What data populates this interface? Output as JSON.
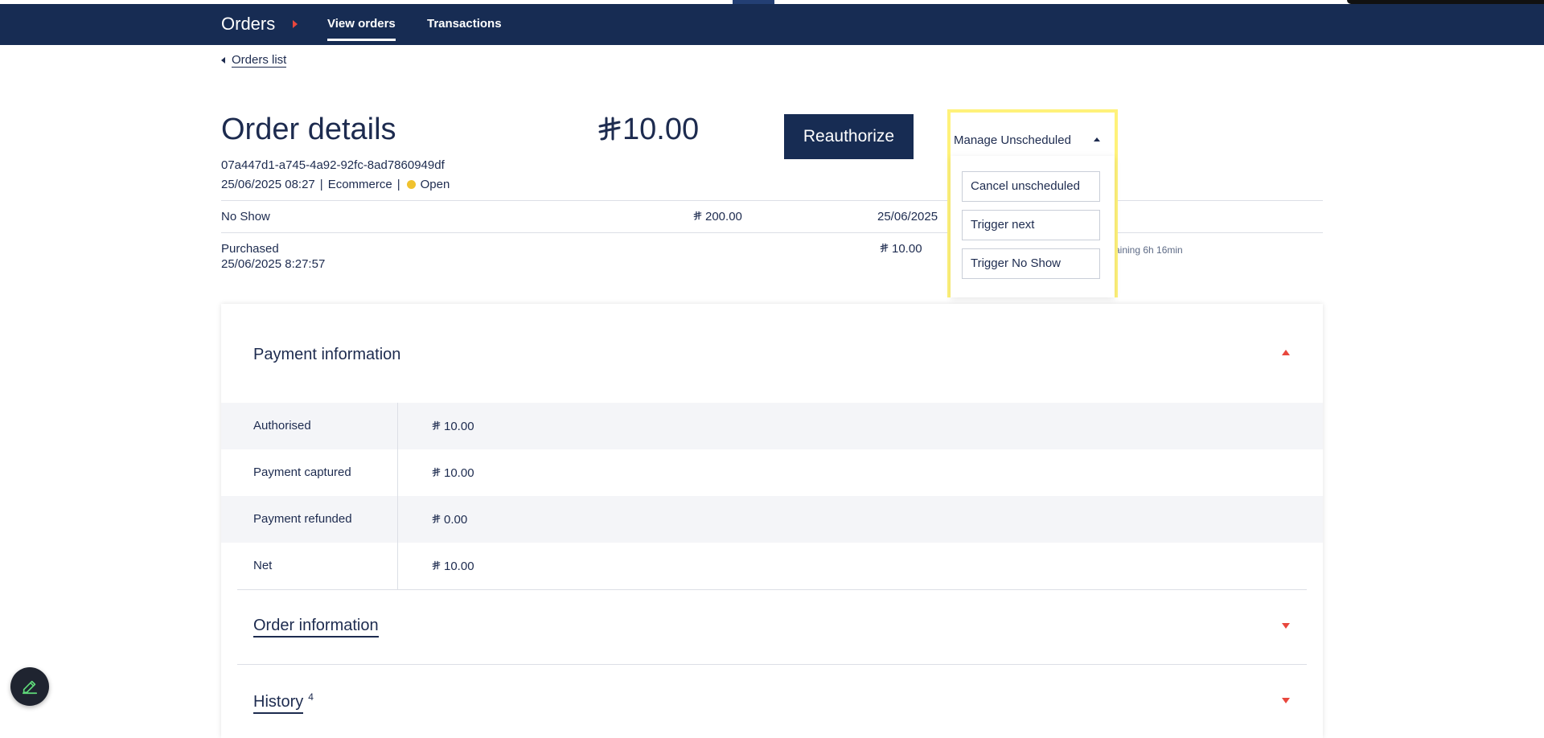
{
  "nav": {
    "brand": "Orders",
    "tabs": [
      {
        "label": "View orders",
        "active": true
      },
      {
        "label": "Transactions",
        "active": false
      }
    ]
  },
  "back_link": "Orders list",
  "header": {
    "title": "Order details",
    "amount": "10.00",
    "order_id": "07a447d1-a745-4a92-92fc-8ad7860949df",
    "datetime": "25/06/2025 08:27",
    "channel": "Ecommerce",
    "status": "Open",
    "reauthorize_label": "Reauthorize"
  },
  "rows": [
    {
      "label": "No Show",
      "amount": "200.00",
      "date": "25/06/2025"
    },
    {
      "label": "Purchased",
      "sub": "25/06/2025 8:27:57",
      "amount": "10.00",
      "remaining": "aining 6h 16min"
    }
  ],
  "manage": {
    "label": "Manage Unscheduled",
    "items": [
      "Cancel unscheduled",
      "Trigger next",
      "Trigger No Show"
    ]
  },
  "payment": {
    "title": "Payment information",
    "rows": [
      {
        "label": "Authorised",
        "value": "10.00"
      },
      {
        "label": "Payment captured",
        "value": "10.00"
      },
      {
        "label": "Payment refunded",
        "value": "0.00"
      },
      {
        "label": "Net",
        "value": "10.00"
      }
    ]
  },
  "sections": {
    "order_info": "Order information",
    "history": "History",
    "history_count": "4"
  },
  "colors": {
    "navy": "#172c53",
    "accent_red": "#e8473d",
    "status_yellow": "#f0c22e",
    "highlight": "#fff27a"
  },
  "icons": {
    "currency": "currency-icon",
    "edit": "pencil-icon"
  }
}
